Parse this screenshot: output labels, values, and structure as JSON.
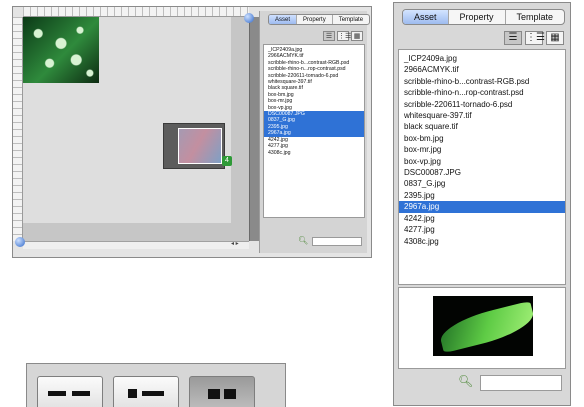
{
  "tabs": [
    "Asset",
    "Property",
    "Template"
  ],
  "view_buttons": [
    {
      "name": "list-view",
      "glyph": "☰"
    },
    {
      "name": "detail-view",
      "glyph": "⋮☰"
    },
    {
      "name": "thumbnail-view",
      "glyph": "▦"
    }
  ],
  "files": [
    "_ICP2409a.jpg",
    "2966ACMYK.tif",
    "scribble-rhino-b...contrast-RGB.psd",
    "scribble-rhino-n...rop-contrast.psd",
    "scribble-220611-tornado-6.psd",
    "whitesquare-397.tif",
    "black square.tif",
    "box-bm.jpg",
    "box-mr.jpg",
    "box-vp.jpg",
    "DSC00087.JPG",
    "0837_G.jpg",
    "2395.jpg",
    "2967a.jpg",
    "4242.jpg",
    "4277.jpg",
    "4308c.jpg"
  ],
  "selected_large": [
    13
  ],
  "selected_small": [
    10,
    11,
    12,
    13
  ],
  "drag_badge": "4",
  "colors": {
    "selection": "#2f72d6",
    "tab_active": "#9dbbef"
  }
}
